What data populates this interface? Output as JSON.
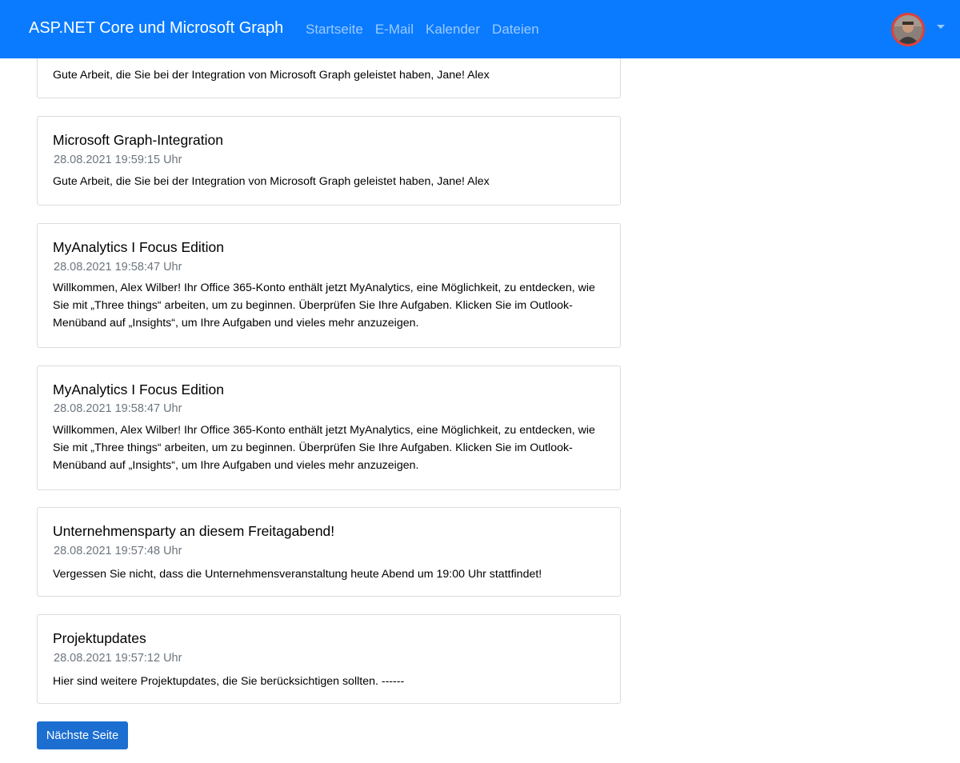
{
  "navbar": {
    "brand": "ASP.NET Core und Microsoft Graph",
    "links": [
      "Startseite",
      "E-Mail",
      "Kalender",
      "Dateien"
    ],
    "bg_color": "#0a7bff"
  },
  "messages": [
    {
      "title": "",
      "date": "",
      "body": "Gute Arbeit, die Sie bei der Integration von Microsoft Graph geleistet haben, Jane! Alex"
    },
    {
      "title": "Microsoft Graph-Integration",
      "date": "28.08.2021 19:59:15 Uhr",
      "body": "Gute Arbeit, die Sie bei der Integration von Microsoft Graph geleistet haben, Jane! Alex"
    },
    {
      "title": "MyAnalytics I Focus Edition",
      "date": "28.08.2021 19:58:47 Uhr",
      "body": "Willkommen, Alex Wilber! Ihr Office 365-Konto enthält jetzt MyAnalytics, eine Möglichkeit, zu entdecken, wie Sie mit „Three things“ arbeiten, um zu beginnen. Überprüfen Sie Ihre Aufgaben. Klicken Sie im Outlook-Menüband auf „Insights“, um Ihre Aufgaben und vieles mehr anzuzeigen."
    },
    {
      "title": "MyAnalytics I Focus Edition",
      "date": "28.08.2021 19:58:47 Uhr",
      "body": "Willkommen, Alex Wilber! Ihr Office 365-Konto enthält jetzt MyAnalytics, eine Möglichkeit, zu entdecken, wie Sie mit „Three things“ arbeiten, um zu beginnen. Überprüfen Sie Ihre Aufgaben. Klicken Sie im Outlook-Menüband auf „Insights“, um Ihre Aufgaben und vieles mehr anzuzeigen."
    },
    {
      "title": "Unternehmensparty an diesem Freitagabend!",
      "date": "28.08.2021 19:57:48 Uhr",
      "body": "Vergessen Sie nicht, dass die Unternehmensveranstaltung heute Abend um 19:00 Uhr stattfindet!"
    },
    {
      "title": "Projektupdates",
      "date": "28.08.2021 19:57:12 Uhr",
      "body": "Hier sind weitere Projektupdates, die Sie berücksichtigen sollten. ------"
    }
  ],
  "pagination": {
    "next_label": "Nächste Seite"
  }
}
